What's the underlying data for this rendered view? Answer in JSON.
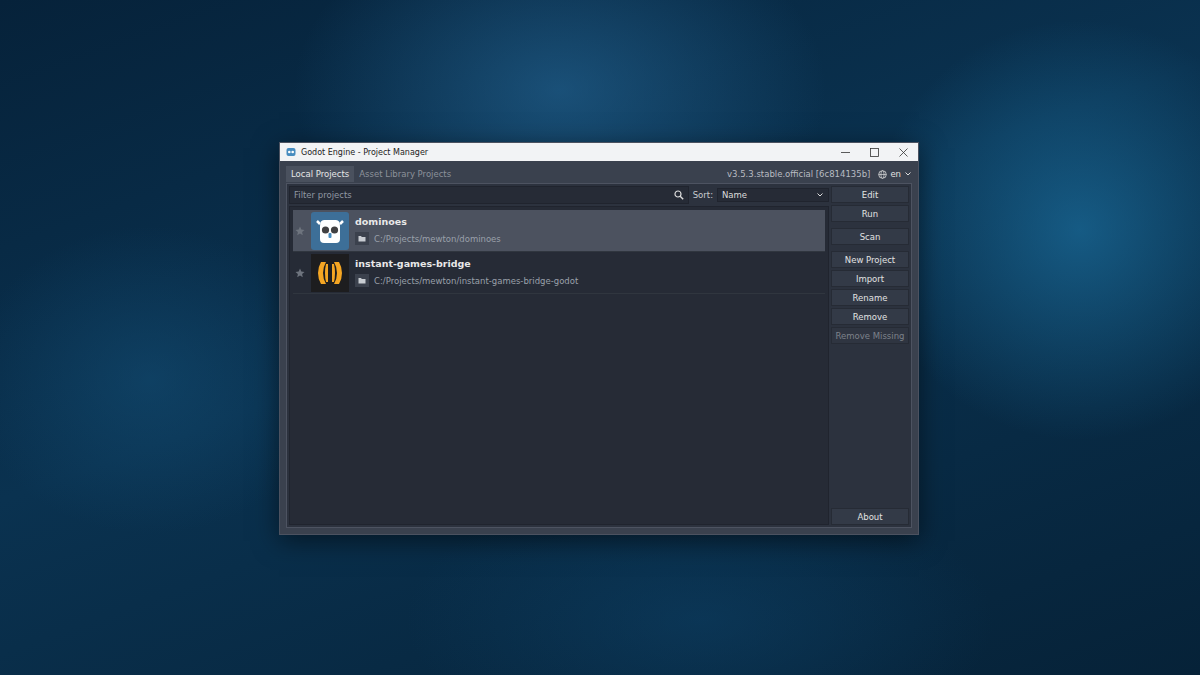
{
  "window": {
    "title": "Godot Engine - Project Manager"
  },
  "tabs": [
    {
      "label": "Local Projects",
      "selected": true
    },
    {
      "label": "Asset Library Projects",
      "selected": false
    }
  ],
  "version": "v3.5.3.stable.official [6c814135b]",
  "language": {
    "value": "en"
  },
  "filter": {
    "placeholder": "Filter projects"
  },
  "sort": {
    "label": "Sort:",
    "value": "Name"
  },
  "projects": [
    {
      "name": "dominoes",
      "path": "C:/Projects/mewton/dominoes",
      "selected": true,
      "favorite": false,
      "kind": "godot"
    },
    {
      "name": "instant-games-bridge",
      "path": "C:/Projects/mewton/instant-games-bridge-godot",
      "selected": false,
      "favorite": false,
      "kind": "bridge"
    }
  ],
  "button_groups": [
    [
      {
        "label": "Edit",
        "disabled": false
      },
      {
        "label": "Run",
        "disabled": false
      }
    ],
    [
      {
        "label": "Scan",
        "disabled": false
      }
    ],
    [
      {
        "label": "New Project",
        "disabled": false
      },
      {
        "label": "Import",
        "disabled": false
      },
      {
        "label": "Rename",
        "disabled": false
      },
      {
        "label": "Remove",
        "disabled": false
      },
      {
        "label": "Remove Missing",
        "disabled": true
      }
    ]
  ],
  "about_button": {
    "label": "About"
  }
}
